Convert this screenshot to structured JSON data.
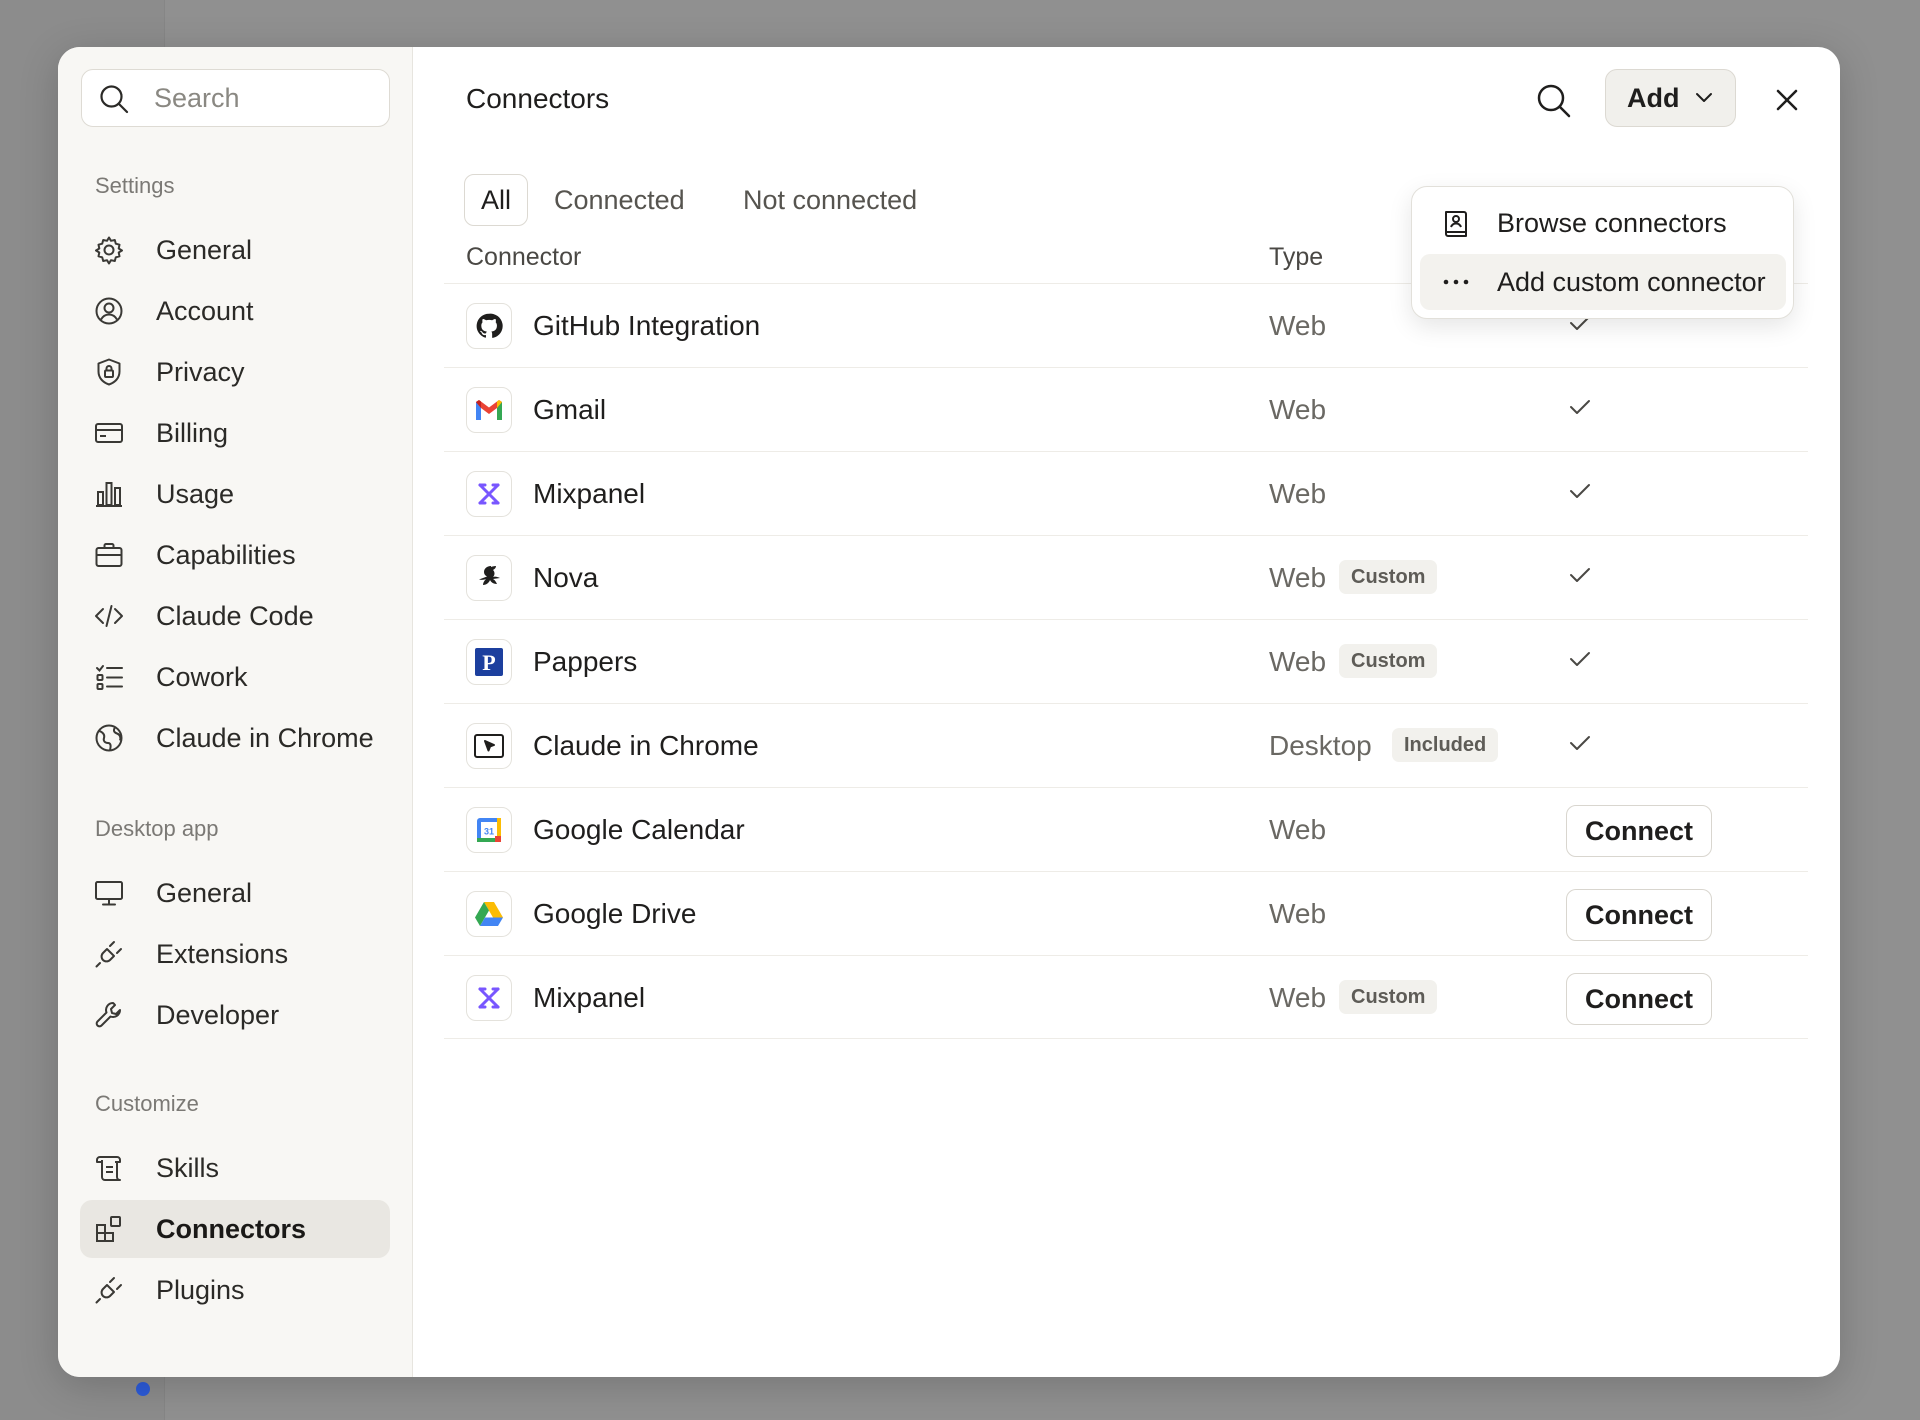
{
  "search": {
    "placeholder": "Search"
  },
  "sidebar": {
    "sections": [
      {
        "label": "Settings",
        "items": [
          {
            "label": "General",
            "icon": "gear-icon"
          },
          {
            "label": "Account",
            "icon": "user-circle-icon"
          },
          {
            "label": "Privacy",
            "icon": "shield-lock-icon"
          },
          {
            "label": "Billing",
            "icon": "credit-card-icon"
          },
          {
            "label": "Usage",
            "icon": "bar-chart-icon"
          },
          {
            "label": "Capabilities",
            "icon": "briefcase-icon"
          },
          {
            "label": "Claude Code",
            "icon": "code-icon"
          },
          {
            "label": "Cowork",
            "icon": "checklist-icon"
          },
          {
            "label": "Claude in Chrome",
            "icon": "globe-icon"
          }
        ]
      },
      {
        "label": "Desktop app",
        "items": [
          {
            "label": "General",
            "icon": "monitor-icon"
          },
          {
            "label": "Extensions",
            "icon": "plug-icon"
          },
          {
            "label": "Developer",
            "icon": "wrench-icon"
          }
        ]
      },
      {
        "label": "Customize",
        "items": [
          {
            "label": "Skills",
            "icon": "scroll-icon"
          },
          {
            "label": "Connectors",
            "icon": "connectors-icon",
            "active": true
          },
          {
            "label": "Plugins",
            "icon": "plug-icon"
          }
        ]
      }
    ]
  },
  "header": {
    "title": "Connectors",
    "add_label": "Add"
  },
  "dropdown": {
    "items": [
      {
        "label": "Browse connectors",
        "icon": "book-user-icon"
      },
      {
        "label": "Add custom connector",
        "icon": "more-dots-icon"
      }
    ]
  },
  "tabs": [
    {
      "label": "All",
      "active": true
    },
    {
      "label": "Connected"
    },
    {
      "label": "Not connected"
    }
  ],
  "table": {
    "columns": {
      "connector": "Connector",
      "type": "Type"
    },
    "rows": [
      {
        "name": "GitHub Integration",
        "type": "Web",
        "badge": "",
        "status": "connected",
        "logo": "github-logo"
      },
      {
        "name": "Gmail",
        "type": "Web",
        "badge": "",
        "status": "connected",
        "logo": "gmail-logo"
      },
      {
        "name": "Mixpanel",
        "type": "Web",
        "badge": "",
        "status": "connected",
        "logo": "mixpanel-logo"
      },
      {
        "name": "Nova",
        "type": "Web",
        "badge": "Custom",
        "status": "connected",
        "logo": "nova-logo"
      },
      {
        "name": "Pappers",
        "type": "Web",
        "badge": "Custom",
        "status": "connected",
        "logo": "pappers-logo"
      },
      {
        "name": "Claude in Chrome",
        "type": "Desktop",
        "badge": "Included",
        "status": "connected",
        "logo": "chrome-cursor-logo"
      },
      {
        "name": "Google Calendar",
        "type": "Web",
        "badge": "",
        "status": "not_connected",
        "logo": "google-calendar-logo"
      },
      {
        "name": "Google Drive",
        "type": "Web",
        "badge": "",
        "status": "not_connected",
        "logo": "google-drive-logo"
      },
      {
        "name": "Mixpanel",
        "type": "Web",
        "badge": "Custom",
        "status": "not_connected",
        "logo": "mixpanel-logo"
      }
    ],
    "connect_label": "Connect"
  },
  "colors": {
    "sidebar_bg": "#f8f7f4",
    "active_item_bg": "#e9e7e2",
    "overlay_bg": "#8f8f8f",
    "mixpanel_purple": "#7856ff",
    "pappers_blue": "#1c3f9e"
  }
}
